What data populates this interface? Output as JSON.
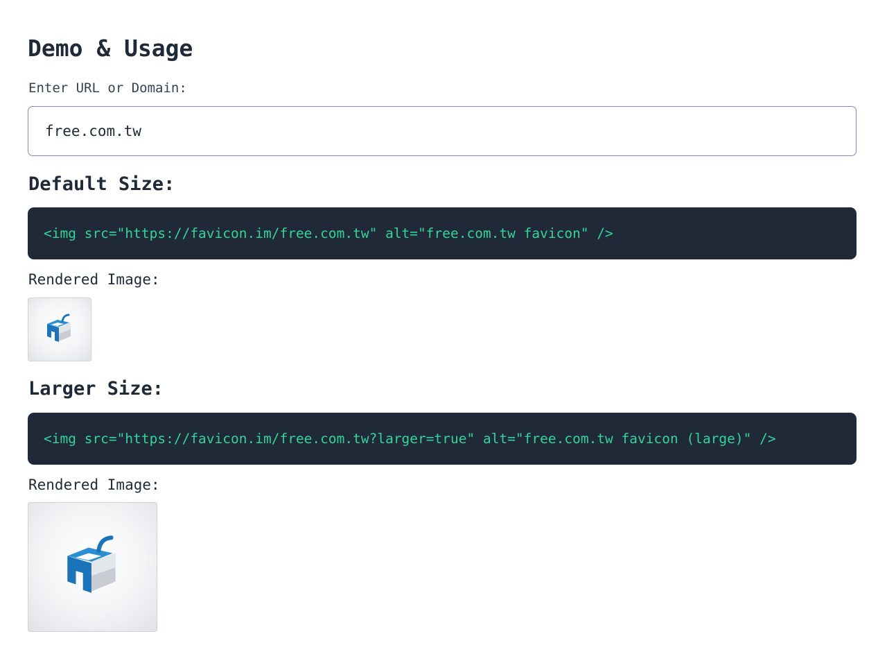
{
  "demo": {
    "title": "Demo & Usage",
    "url_label": "Enter URL or Domain:",
    "url_value": "free.com.tw"
  },
  "default_size": {
    "heading": "Default Size:",
    "code": "<img src=\"https://favicon.im/free.com.tw\" alt=\"free.com.tw favicon\" />",
    "rendered_label": "Rendered Image:",
    "icon": "free-com-tw-favicon"
  },
  "larger_size": {
    "heading": "Larger Size:",
    "code": "<img src=\"https://favicon.im/free.com.tw?larger=true\" alt=\"free.com.tw favicon (large)\" />",
    "rendered_label": "Rendered Image:",
    "icon": "free-com-tw-favicon"
  },
  "colors": {
    "code_background": "#1f2937",
    "code_text": "#34d399",
    "input_border": "#8b84c4",
    "logo_blue": "#1b73b8"
  }
}
